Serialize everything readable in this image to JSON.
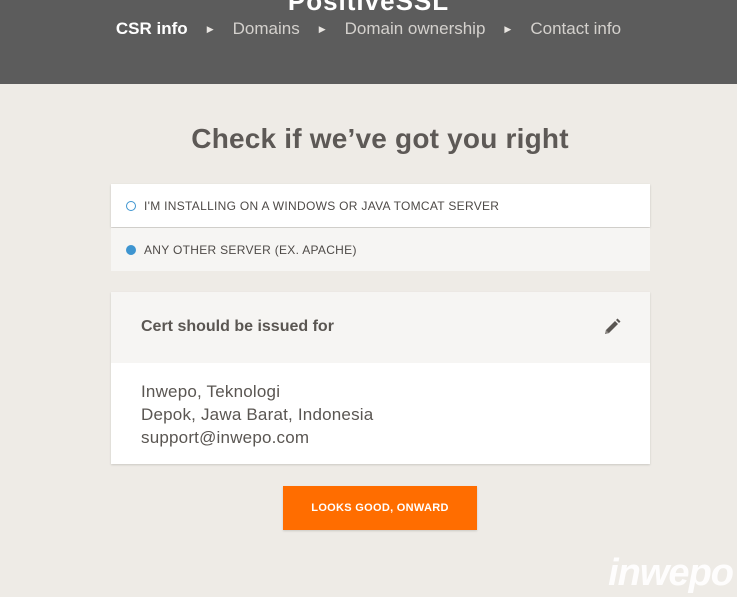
{
  "header": {
    "brand": "PositiveSSL",
    "steps": [
      {
        "label": "CSR info",
        "active": true
      },
      {
        "label": "Domains",
        "active": false
      },
      {
        "label": "Domain ownership",
        "active": false
      },
      {
        "label": "Contact info",
        "active": false
      }
    ],
    "separator": "▶"
  },
  "main": {
    "title": "Check if we’ve got you right",
    "server_options": [
      {
        "label": "I'M INSTALLING ON A WINDOWS OR JAVA TOMCAT SERVER",
        "selected": false
      },
      {
        "label": "ANY OTHER SERVER (EX. APACHE)",
        "selected": true
      }
    ],
    "cert_card": {
      "title": "Cert should be issued for",
      "edit_icon": "pencil-icon",
      "lines": [
        "Inwepo, Teknologi",
        "Depok, Jawa Barat, Indonesia",
        "support@inwepo.com"
      ]
    },
    "submit_label": "LOOKS GOOD, ONWARD"
  },
  "watermark": "inwepo",
  "colors": {
    "accent": "#ff6d00",
    "radio": "#3e95d0",
    "header_bg": "#5c5c5c",
    "page_bg": "#eeebe6"
  }
}
